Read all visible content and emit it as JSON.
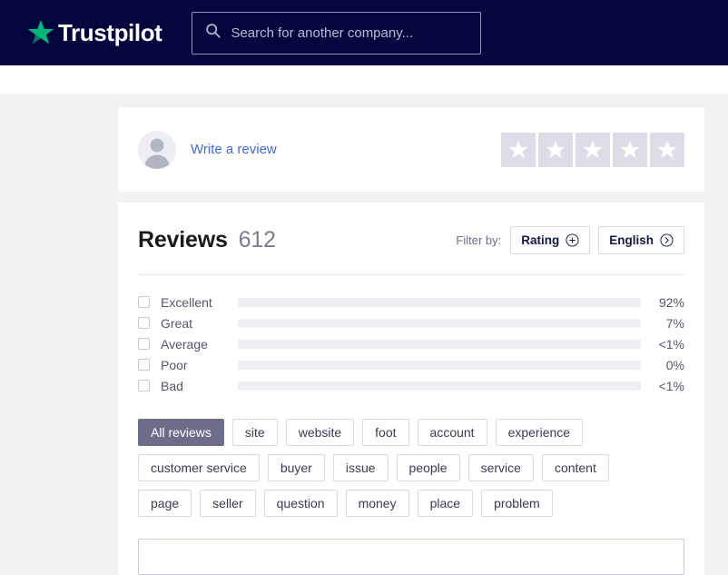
{
  "header": {
    "logo_text": "Trustpilot",
    "logo_star_icon": "star-icon",
    "search_icon": "search-icon",
    "search_placeholder": "Search for another company...",
    "search_value": "",
    "bg_color": "#03053d",
    "star_color": "#00b67a"
  },
  "write_review_card": {
    "avatar_icon": "user-avatar-icon",
    "link_label": "Write a review",
    "link_color": "#4169e1",
    "star_rating": {
      "icon": "star-icon",
      "count": 5,
      "filled": 0,
      "box_color": "#dcdde6"
    }
  },
  "reviews": {
    "title": "Reviews",
    "count": "612",
    "filter_label": "Filter by:",
    "filters": [
      {
        "label": "Rating",
        "icon": "plus-circle-icon"
      },
      {
        "label": "English",
        "icon": "chevron-right-circle-icon"
      }
    ]
  },
  "chart_data": {
    "type": "bar",
    "title": "Rating distribution",
    "orientation": "horizontal",
    "categories": [
      "Excellent",
      "Great",
      "Average",
      "Poor",
      "Bad"
    ],
    "values": [
      92,
      7,
      0.5,
      0,
      0.5
    ],
    "labels": [
      "92%",
      "7%",
      "<1%",
      "0%",
      "<1%"
    ],
    "xlabel": "",
    "ylabel": "",
    "xlim": [
      0,
      100
    ],
    "grid": false,
    "legend": "none",
    "bar_color": "#6d6d8a",
    "track_color": "#f0f0f4",
    "checkboxes_checked": [
      false,
      false,
      false,
      false,
      false
    ]
  },
  "tags": {
    "rows": [
      [
        {
          "label": "All reviews",
          "active": true
        },
        {
          "label": "site",
          "active": false
        },
        {
          "label": "website",
          "active": false
        },
        {
          "label": "foot",
          "active": false
        },
        {
          "label": "account",
          "active": false
        },
        {
          "label": "experience",
          "active": false
        }
      ],
      [
        {
          "label": "customer service",
          "active": false
        },
        {
          "label": "buyer",
          "active": false
        },
        {
          "label": "issue",
          "active": false
        },
        {
          "label": "people",
          "active": false
        },
        {
          "label": "service",
          "active": false
        },
        {
          "label": "content",
          "active": false
        },
        {
          "label": "page",
          "active": false
        }
      ],
      [
        {
          "label": "seller",
          "active": false
        },
        {
          "label": "question",
          "active": false
        },
        {
          "label": "money",
          "active": false
        },
        {
          "label": "place",
          "active": false
        },
        {
          "label": "problem",
          "active": false
        }
      ]
    ]
  },
  "bottom_input": {
    "value": "",
    "placeholder": ""
  }
}
